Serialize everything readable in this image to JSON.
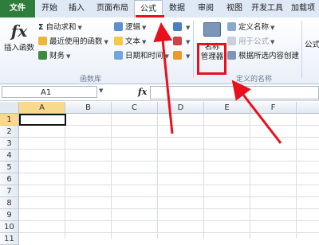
{
  "tabs": [
    "文件",
    "开始",
    "插入",
    "页面布局",
    "公式",
    "数据",
    "审阅",
    "视图",
    "开发工具",
    "加载项"
  ],
  "ribbon": {
    "insert_function": "插入函数",
    "autosum": "自动求和",
    "recent": "最近使用的函数",
    "finance": "财务",
    "logic": "逻辑",
    "text": "文本",
    "datetime": "日期和时间",
    "group_function_library": "函数库",
    "name_manager_line1": "名称",
    "name_manager_line2": "管理器",
    "define_name": "定义名称",
    "use_in_formula": "用于公式",
    "create_from_selection": "根据所选内容创建",
    "group_defined_names": "定义的名称",
    "formula_partial": "公式"
  },
  "formula_bar": {
    "name_box": "A1",
    "fx": "fx"
  },
  "columns": [
    "A",
    "B",
    "C",
    "D",
    "E",
    "F"
  ],
  "rows": [
    "1",
    "2",
    "3",
    "4",
    "5",
    "6",
    "7",
    "8",
    "9",
    "10",
    "11"
  ],
  "colors": {
    "file_tab": "#2f7d3c",
    "annotation": "#e8101c",
    "selected_header": "#f9d98b"
  }
}
